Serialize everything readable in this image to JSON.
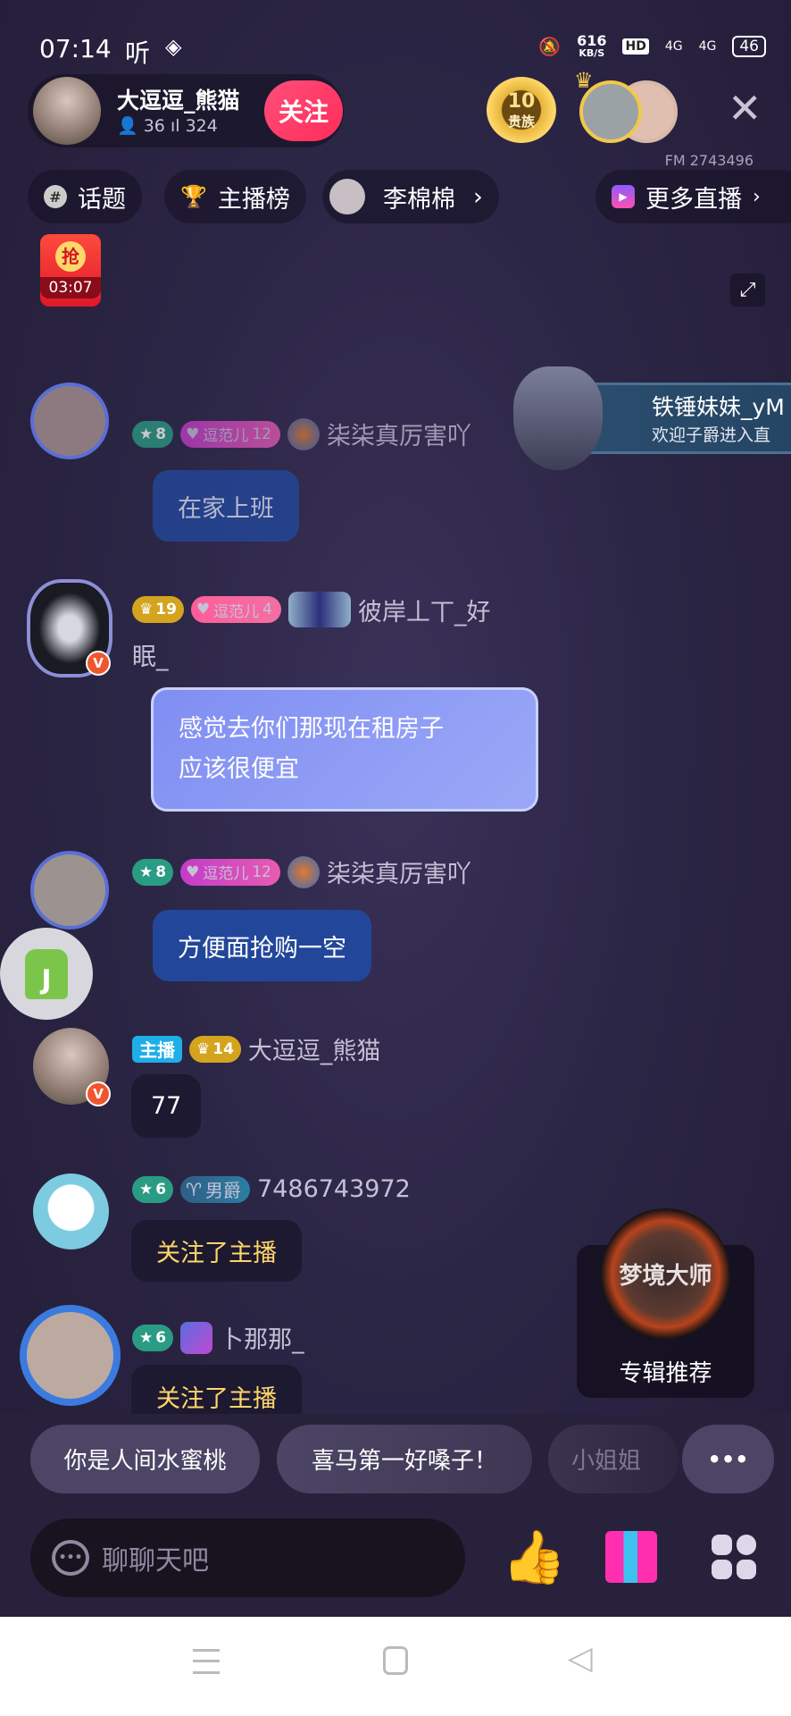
{
  "status_bar": {
    "time": "07:14",
    "app_indicator": "听",
    "speed": "616",
    "speed_unit": "KB/S",
    "hd": "HD",
    "net1": "4G",
    "net2": "4G",
    "battery": "46"
  },
  "host": {
    "name": "大逗逗_熊猫",
    "followers": "36",
    "popularity": "324",
    "follow_label": "关注"
  },
  "noble": {
    "level": "10",
    "label": "贵族"
  },
  "fm_id": "FM 2743496",
  "tabs": [
    {
      "label": "话题",
      "icon": "hashtag-icon"
    },
    {
      "label": "主播榜",
      "icon": "trophy-icon"
    },
    {
      "label": "李棉棉",
      "icon": "avatar"
    },
    {
      "label": "更多直播",
      "icon": "tv-icon"
    }
  ],
  "red_packet": {
    "label": "抢",
    "timer": "03:07"
  },
  "welcome": {
    "name": "铁锤妹妹_yM",
    "message": "欢迎子爵进入直"
  },
  "messages": [
    {
      "level": "8",
      "fan_label": "逗范儿",
      "fan_level": "12",
      "name": "柒柒真厉害吖",
      "text": "在家上班",
      "style": "blue"
    },
    {
      "level": "19",
      "fan_label": "逗范儿",
      "fan_level": "4",
      "name": "彼岸丄丅_好",
      "name2": "眠_",
      "text1": "感觉去你们那现在租房子",
      "text2": "应该很便宜",
      "style": "purple"
    },
    {
      "level": "8",
      "fan_label": "逗范儿",
      "fan_level": "12",
      "name": "柒柒真厉害吖",
      "text": "方便面抢购一空",
      "style": "blue"
    },
    {
      "host_tag": "主播",
      "level": "14",
      "name": "大逗逗_熊猫",
      "text": "77",
      "style": "dark"
    },
    {
      "level": "6",
      "rank": "男爵",
      "name": "7486743972",
      "text": "关注了主播",
      "style": "gold"
    },
    {
      "level": "6",
      "name": "卜那那_",
      "text": "关注了主播",
      "style": "gold"
    }
  ],
  "album": {
    "cover_title": "梦境大师",
    "label": "专辑推荐"
  },
  "quick_replies": [
    "你是人间水蜜桃",
    "喜马第一好嗓子！",
    "小姐姐"
  ],
  "more_label": "•••",
  "input": {
    "placeholder": "聊聊天吧"
  },
  "colors": {
    "follow": "#ff2c5a",
    "blue_bubble": "#22479a",
    "purple_bubble": "#8d9cf6",
    "gold_text": "#ffd76a",
    "background": "#2c2646"
  }
}
